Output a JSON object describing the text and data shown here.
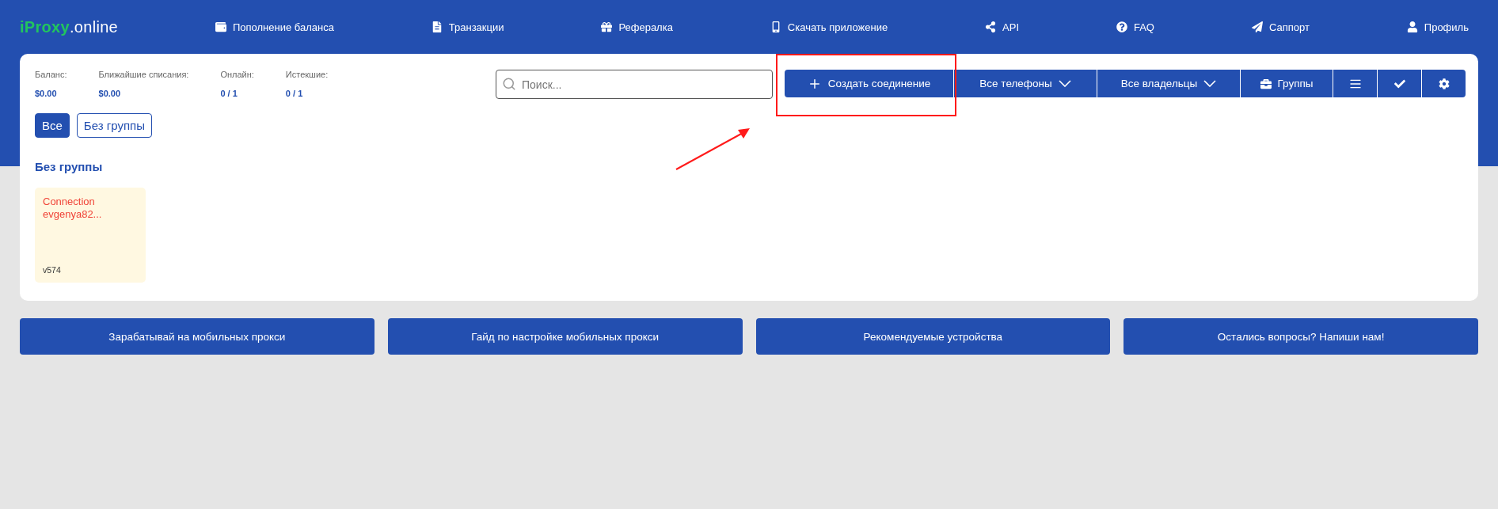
{
  "logo": {
    "brand": "iProxy",
    "suffix": ".online"
  },
  "nav": [
    {
      "kind": "wallet",
      "label": "Пополнение баланса"
    },
    {
      "kind": "document",
      "label": "Транзакции"
    },
    {
      "kind": "gift",
      "label": "Рефералка"
    },
    {
      "kind": "phone",
      "label": "Скачать приложение"
    },
    {
      "kind": "nodes",
      "label": "API"
    },
    {
      "kind": "question",
      "label": "FAQ"
    },
    {
      "kind": "send",
      "label": "Саппорт"
    },
    {
      "kind": "user",
      "label": "Профиль"
    }
  ],
  "stats": [
    {
      "label": "Баланс:",
      "value": "$0.00"
    },
    {
      "label": "Ближайшие списания:",
      "value": "$0.00"
    },
    {
      "label": "Онлайн:",
      "value": "0 / 1"
    },
    {
      "label": "Истекшие:",
      "value": "0 / 1"
    }
  ],
  "search": {
    "placeholder": "Поиск..."
  },
  "toolbar": [
    {
      "kind": "create",
      "label": "Создать соединение"
    },
    {
      "kind": "dropdown",
      "label": "Все телефоны"
    },
    {
      "kind": "dropdown",
      "label": "Все владельцы"
    },
    {
      "kind": "groups",
      "label": "Группы"
    },
    {
      "kind": "list"
    },
    {
      "kind": "check"
    },
    {
      "kind": "settings"
    }
  ],
  "filters": [
    {
      "label": "Все",
      "selected": true
    },
    {
      "label": "Без группы",
      "selected": false
    }
  ],
  "section_title": "Без группы",
  "connections": [
    {
      "name": "Connection evgenya82...",
      "version": "v574"
    }
  ],
  "footer_buttons": [
    "Зарабатывай на мобильных прокси",
    "Гайд по настройке мобильных прокси",
    "Рекомендуемые устройства",
    "Остались вопросы? Напиши нам!"
  ]
}
